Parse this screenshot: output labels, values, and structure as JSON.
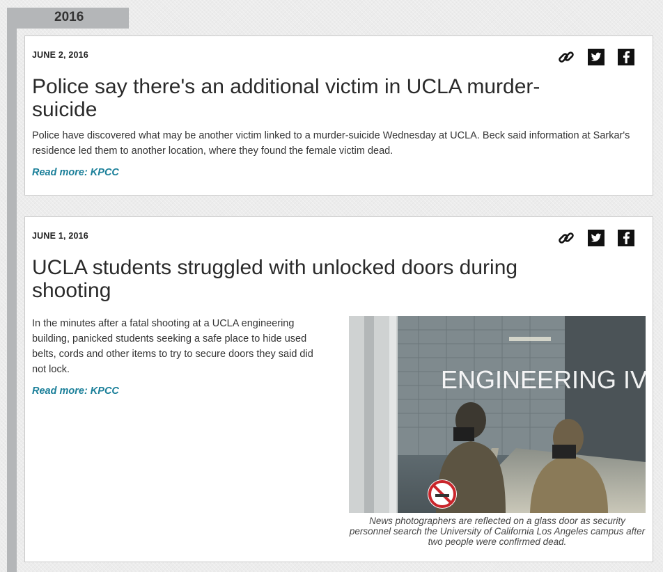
{
  "timeline": {
    "year": "2016"
  },
  "articles": [
    {
      "date": "JUNE 2, 2016",
      "headline": "Police say there's an additional victim in UCLA murder-suicide",
      "summary": "Police have discovered what may be another victim linked to a murder-suicide Wednesday at UCLA. Beck said information at Sarkar's residence led them to another location, where they found the female victim dead.",
      "read_more": "Read more: KPCC",
      "share_icons": [
        "link-icon",
        "twitter-icon",
        "facebook-icon"
      ]
    },
    {
      "date": "JUNE 1, 2016",
      "headline": "UCLA students struggled with unlocked doors during shooting",
      "summary": "In the minutes after a fatal shooting at a UCLA engineering building, panicked students seeking a safe place to hide used belts, cords and other items to try to secure doors they said did not lock.",
      "read_more": "Read more: KPCC",
      "share_icons": [
        "link-icon",
        "twitter-icon",
        "facebook-icon"
      ],
      "photo": {
        "sign_text": "ENGINEERING IV",
        "caption": "News photographers are reflected on a glass door as security personnel search the University of California Los Angeles campus after two people were confirmed dead."
      }
    }
  ],
  "colors": {
    "link_accent": "#1a7f99",
    "timeline_gray": "#b4b6b8"
  }
}
